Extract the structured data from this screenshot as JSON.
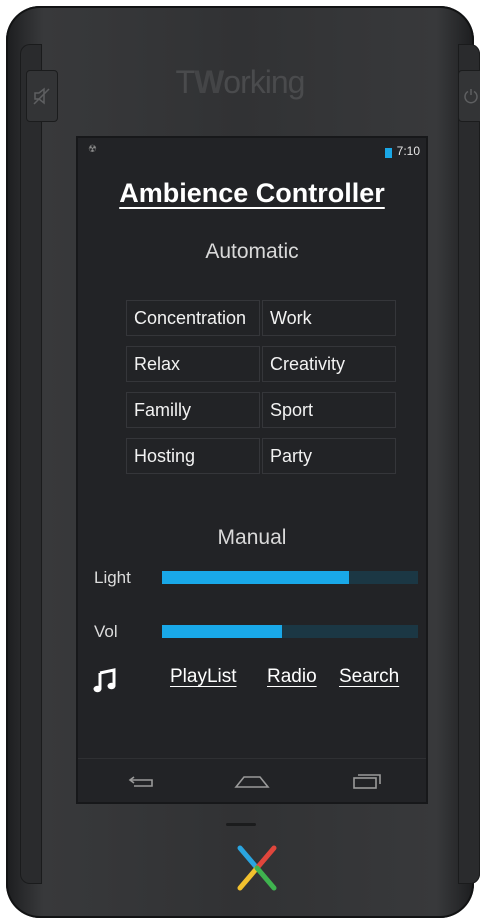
{
  "device": {
    "brand_prefix": "T",
    "brand_bold": "W",
    "brand_suffix": "orking"
  },
  "status_bar": {
    "time": "7:10"
  },
  "app": {
    "title": "Ambience Controller",
    "automatic_heading": "Automatic",
    "modes": [
      "Concentration",
      "Work",
      "Relax",
      "Creativity",
      "Familly",
      "Sport",
      "Hosting",
      "Party"
    ],
    "manual_heading": "Manual",
    "light_label": "Light",
    "light_level": 0.73,
    "vol_label": "Vol",
    "vol_level": 0.47,
    "music_links": [
      "PlayList",
      "Radio",
      "Search"
    ]
  },
  "colors": {
    "accent": "#19a8e8",
    "track": "#1b3744",
    "screen_bg": "#222326"
  },
  "icons": {
    "mute": "speaker-mute-icon",
    "power": "power-icon",
    "music": "music-note-icon",
    "back": "back-icon",
    "home": "home-icon",
    "recents": "recent-apps-icon"
  }
}
